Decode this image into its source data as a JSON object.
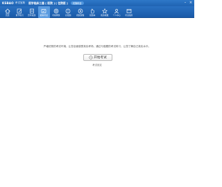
{
  "app": {
    "logo": "KSBAO",
    "logo_sub": "考试宝典",
    "title": "医学临床三基 [ 医院 ] [ 住院医 ]",
    "pill": "切换科目"
  },
  "toolbar": {
    "items": [
      {
        "label": "首页",
        "icon": "home-icon"
      },
      {
        "label": "章节练习",
        "icon": "pencil-icon"
      },
      {
        "label": "历年真题",
        "icon": "book-icon"
      },
      {
        "label": "模拟考试",
        "icon": "exam-icon"
      },
      {
        "label": "考前押题",
        "icon": "target-icon"
      },
      {
        "label": "易错题",
        "icon": "alert-icon"
      },
      {
        "label": "视频课程",
        "icon": "play-icon"
      },
      {
        "label": "错题本",
        "icon": "hand-icon"
      },
      {
        "label": "我的收藏",
        "icon": "star-icon"
      },
      {
        "label": "个人中心",
        "icon": "user-icon"
      },
      {
        "label": "考试指南",
        "icon": "guide-icon"
      }
    ]
  },
  "main": {
    "intro": "严格仿照的考试环境，让您全面感受真实考场，通过与做题的考试练习，让您了解自己真实水平。",
    "start_label": "开始考试",
    "settings_link": "考试设定"
  }
}
